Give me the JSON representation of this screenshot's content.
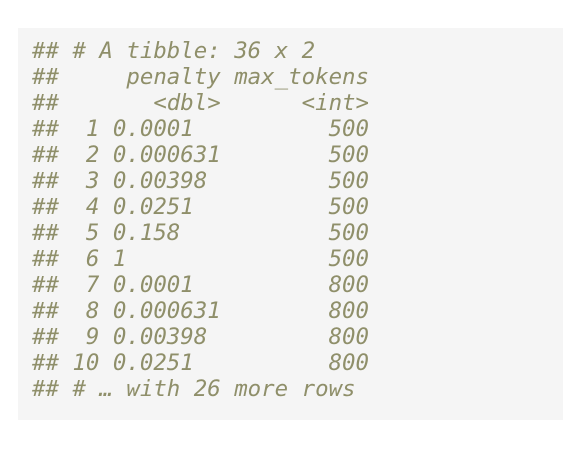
{
  "output": {
    "lines": [
      "## # A tibble: 36 x 2",
      "##     penalty max_tokens",
      "##       <dbl>      <int>",
      "##  1 0.0001          500",
      "##  2 0.000631        500",
      "##  3 0.00398         500",
      "##  4 0.0251          500",
      "##  5 0.158           500",
      "##  6 1               500",
      "##  7 0.0001          800",
      "##  8 0.000631        800",
      "##  9 0.00398         800",
      "## 10 0.0251          800",
      "## # … with 26 more rows"
    ]
  },
  "colors": {
    "text": "#8f8f6a",
    "background": "#f5f5f5"
  }
}
